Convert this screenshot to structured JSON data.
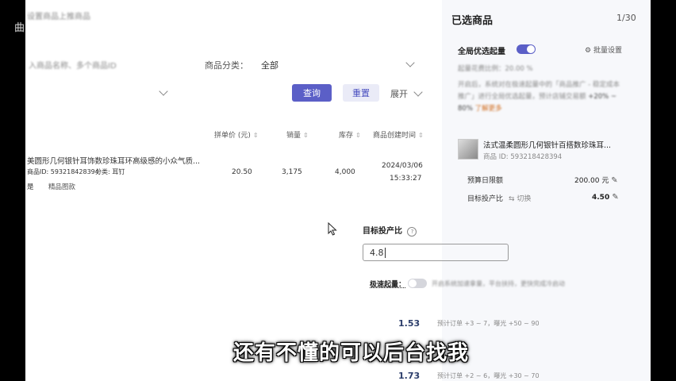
{
  "brand": "曲奇",
  "filters": {
    "section_title": "设置商品上推商品",
    "search_text": "入商品名称、多个商品ID",
    "category_label": "商品分类：",
    "category_value": "全部",
    "query_button": "查询",
    "reset_button": "重置",
    "expand_button": "展开"
  },
  "table": {
    "headers": [
      "拼单价 (元)",
      "销量",
      "库存",
      "商品创建时间"
    ],
    "row": {
      "title": "美圆形几何银针耳饰数珍珠耳环高级感的小众气质...",
      "id_line": "商品ID: 593218428394",
      "category": "分类: 耳钉",
      "tag_prefix": "是",
      "tag": "精品图款",
      "price": "20.50",
      "sales": "3,175",
      "stock": "4,000",
      "date": "2024/03/06",
      "time": "15:33:27"
    }
  },
  "panel": {
    "title": "已选商品",
    "count": "1/30",
    "global_label": "全局优选起量",
    "batch_settings": "批量设置",
    "ratio_text": "起量花费比例：20.00 %",
    "desc": "开启后，系统对在极速起量中的「商品推广 - 稳定成本推广」进行全局优选起量，预计店铺交易额",
    "desc_tail": "+20% ~ 80%",
    "learn_more": "了解更多",
    "product_title": "法式温柔圆形几何银针百搭数珍珠耳...",
    "product_id": "商品 ID: 593218428394",
    "budget_label": "预算日限额",
    "budget_value": "200.00 元",
    "target_label": "目标投产比",
    "switch_label": "切换",
    "target_value": "4.50"
  },
  "popup": {
    "label": "目标投产比",
    "input_value": "4.8",
    "quick_label": "极速起量：",
    "quick_desc": "开启系统加速拿量，平台扶持，更快完成冷启动",
    "options": [
      {
        "ratio": "1.53",
        "desc": "预计订单 +3 ~ 7，曝光 +50 ~ 90"
      },
      {
        "ratio": "1.73",
        "desc": "预计订单 +2 ~ 6，曝光 +30 ~ 70"
      }
    ]
  },
  "subtitle": "还有不懂的可以后台找我",
  "colors": {
    "accent": "#5b5fc7",
    "accent_light": "#eaebf7",
    "panel_bg": "#f7f8fb",
    "link": "#d06a1a"
  }
}
